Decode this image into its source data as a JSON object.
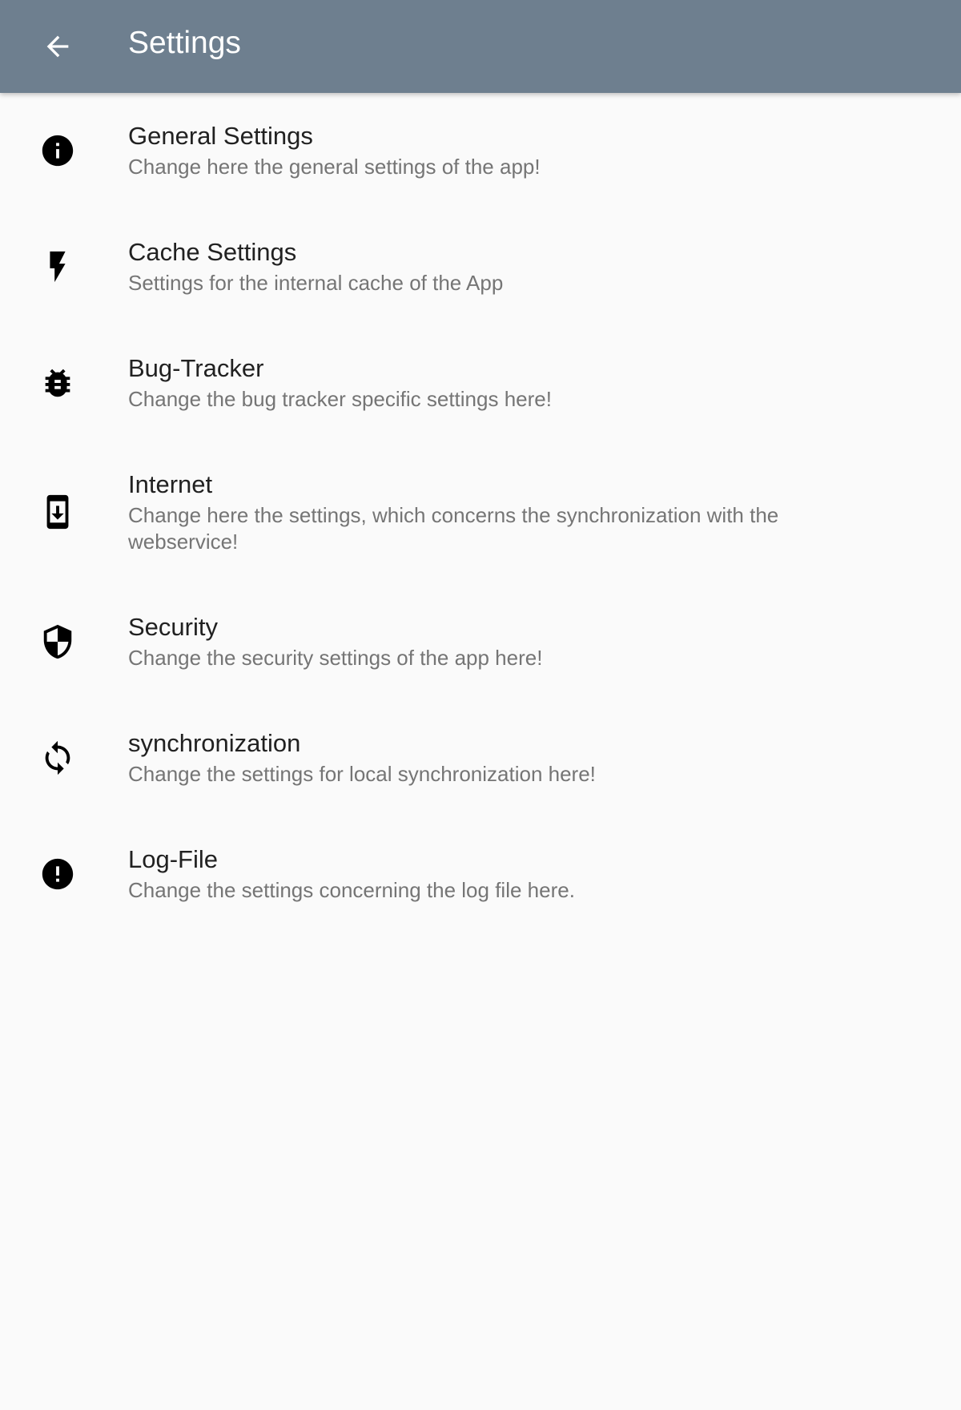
{
  "appbar": {
    "title": "Settings",
    "back_icon": "arrow-back-icon",
    "background_color": "#6e7f8f"
  },
  "items": [
    {
      "title": "General Settings",
      "summary": "Change here the general settings of the app!",
      "icon": "info-icon"
    },
    {
      "title": "Cache Settings",
      "summary": "Settings for the internal cache of the App",
      "icon": "flash-icon"
    },
    {
      "title": "Bug-Tracker",
      "summary": "Change the bug tracker specific settings here!",
      "icon": "bug-icon"
    },
    {
      "title": "Internet",
      "summary": "Change here the settings, which concerns the synchronization with the webservice!",
      "icon": "system-update-icon"
    },
    {
      "title": "Security",
      "summary": "Change the security settings of the app here!",
      "icon": "shield-icon"
    },
    {
      "title": "synchronization",
      "summary": "Change the settings for local synchronization here!",
      "icon": "sync-icon"
    },
    {
      "title": "Log-File",
      "summary": "Change the settings concerning the log file here.",
      "icon": "error-icon"
    }
  ]
}
